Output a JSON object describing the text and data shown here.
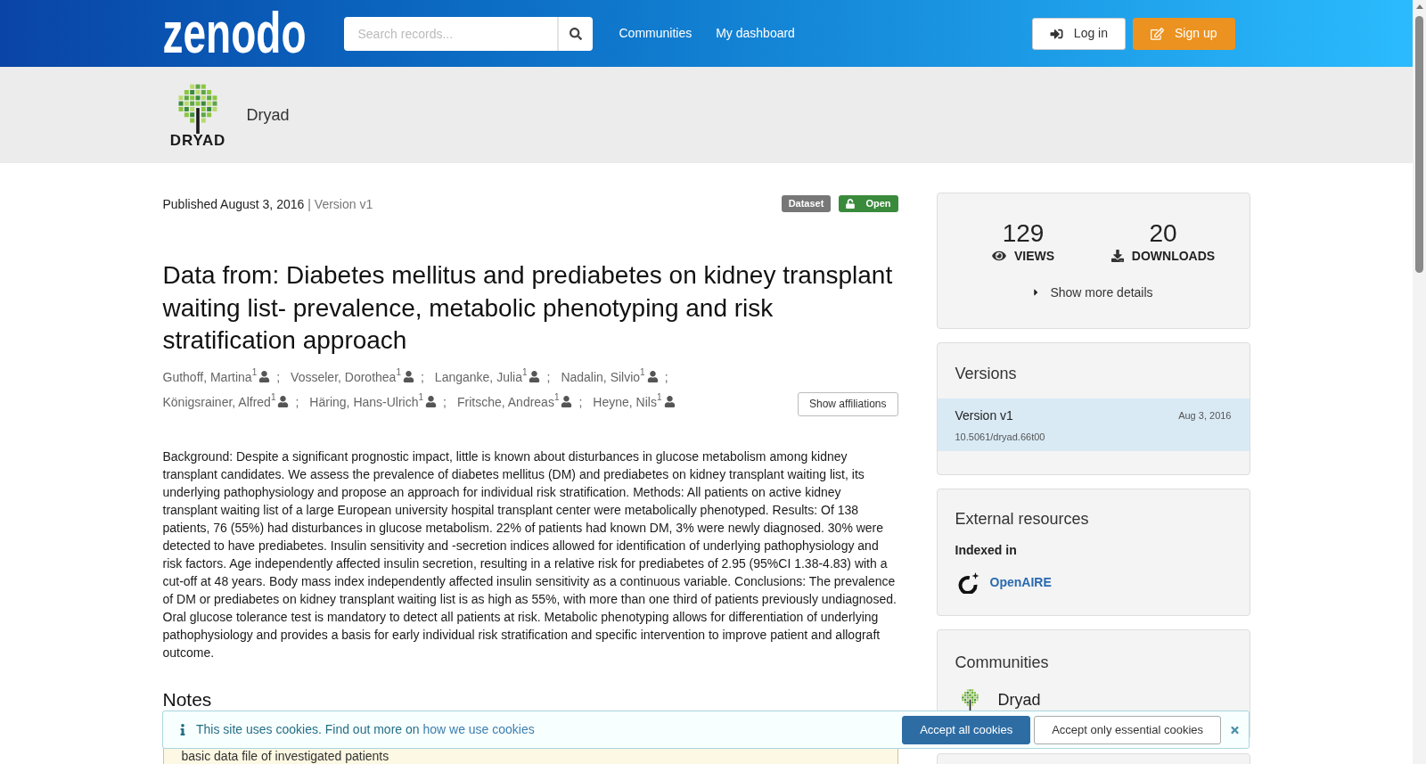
{
  "header": {
    "logo": "zenodo",
    "search": {
      "placeholder": "Search records..."
    },
    "nav": [
      "Communities",
      "My dashboard"
    ],
    "buttons": [
      {
        "kind": "login",
        "label": "Log in"
      },
      {
        "kind": "signup",
        "label": "Sign up"
      }
    ]
  },
  "community_banner": {
    "logo_text": "DRYAD",
    "name": "Dryad"
  },
  "record": {
    "published": "Published August 3, 2016",
    "version": "| Version v1",
    "badges": [
      {
        "kind": "type",
        "label": "Dataset"
      },
      {
        "kind": "access",
        "label": "Open"
      }
    ],
    "title": "Data from: Diabetes mellitus and prediabetes on kidney transplant waiting list- prevalence, metabolic phenotyping and risk stratification approach",
    "authors": [
      {
        "name": "Guthoff, Martina",
        "affiliation": "1",
        "separator": ";"
      },
      {
        "name": "Vosseler, Dorothea",
        "affiliation": "1",
        "separator": ";"
      },
      {
        "name": "Langanke, Julia",
        "affiliation": "1",
        "separator": ";"
      },
      {
        "name": "Nadalin, Silvio",
        "affiliation": "1",
        "separator": ";"
      },
      {
        "name": "Königsrainer, Alfred",
        "affiliation": "1",
        "separator": ";"
      },
      {
        "name": "Häring, Hans-Ulrich",
        "affiliation": "1",
        "separator": ";"
      },
      {
        "name": "Fritsche, Andreas",
        "affiliation": "1",
        "separator": ";"
      },
      {
        "name": "Heyne, Nils",
        "affiliation": "1"
      }
    ],
    "show_affiliations": "Show affiliations",
    "abstract": "Background: Despite a significant prognostic impact, little is known about disturbances in glucose metabolism among kidney transplant candidates. We assess the prevalence of diabetes mellitus (DM) and prediabetes on kidney transplant waiting list, its underlying pathophysiology and propose an approach for individual risk stratification. Methods: All patients on active kidney transplant waiting list of a large European university hospital transplant center were metabolically phenotyped. Results: Of 138 patients, 76 (55%) had disturbances in glucose metabolism. 22% of patients had known DM, 3% were newly diagnosed. 30% were detected to have prediabetes. Insulin sensitivity and -secretion indices allowed for identification of underlying pathophysiology and risk factors. Age independently affected insulin secretion, resulting in a relative risk for prediabetes of 2.95 (95%CI 1.38-4.83) with a cut-off at 48 years. Body mass index independently affected insulin sensitivity as a continuous variable. Conclusions: The prevalence of DM or prediabetes on kidney transplant waiting list is as high as 55%, with more than one third of patients previously undiagnosed. Oral glucose tolerance test is mandatory to detect all patients at risk. Metabolic phenotyping allows for differentiation of underlying pathophysiology and provides a basis for early individual risk stratification and specific intervention to improve patient and allograft outcome.",
    "notes_heading": "Notes",
    "notes_text": "basic data file of investigated patients"
  },
  "sidebar": {
    "stats": [
      {
        "kind": "views",
        "value": "129",
        "label": "VIEWS"
      },
      {
        "kind": "downloads",
        "value": "20",
        "label": "DOWNLOADS"
      }
    ],
    "more_details": "Show more details",
    "versions": {
      "heading": "Versions",
      "items": [
        {
          "label": "Version v1",
          "date": "Aug 3, 2016",
          "doi": "10.5061/dryad.66t00",
          "selected": true
        }
      ]
    },
    "external": {
      "heading": "External resources",
      "subheading": "Indexed in",
      "links": [
        "OpenAIRE"
      ]
    },
    "communities": {
      "heading": "Communities",
      "items": [
        "Dryad"
      ]
    }
  },
  "cookie_banner": {
    "message": "This site uses cookies. Find out more on",
    "link": "how we use cookies",
    "buttons": [
      {
        "kind": "primary",
        "label": "Accept all cookies"
      },
      {
        "kind": "secondary",
        "label": "Accept only essential cookies"
      }
    ]
  }
}
